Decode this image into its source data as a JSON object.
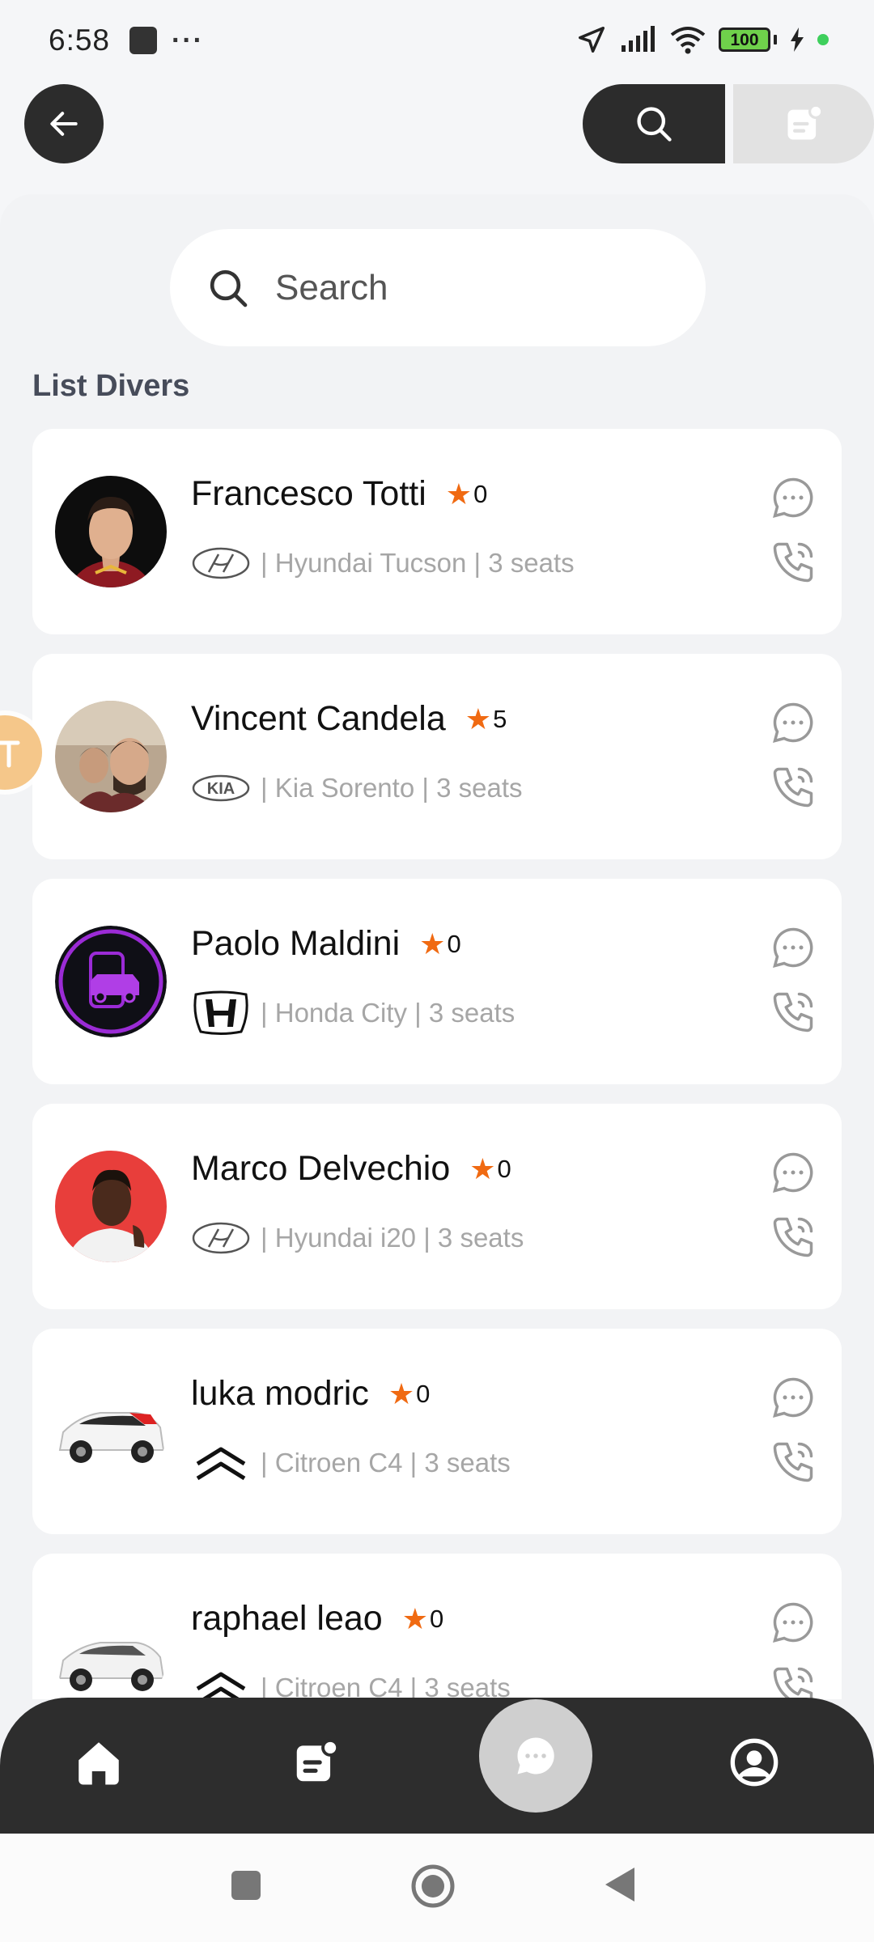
{
  "status_bar": {
    "time": "6:58",
    "battery": "100"
  },
  "search": {
    "placeholder": "Search"
  },
  "list_title": "List Divers",
  "drivers": [
    {
      "name": "Francesco Totti",
      "rating": "0",
      "car": "| Hyundai Tucson | 3 seats",
      "brand_icon": "hyundai-logo-icon"
    },
    {
      "name": "Vincent Candela",
      "rating": "5",
      "car": "| Kia Sorento | 3 seats",
      "brand_icon": "kia-logo-icon"
    },
    {
      "name": "Paolo Maldini",
      "rating": "0",
      "car": "| Honda City | 3 seats",
      "brand_icon": "honda-logo-icon"
    },
    {
      "name": "Marco Delvechio",
      "rating": "0",
      "car": "| Hyundai i20 | 3 seats",
      "brand_icon": "hyundai-logo-icon"
    },
    {
      "name": "luka modric",
      "rating": "0",
      "car": "| Citroen C4 | 3 seats",
      "brand_icon": "citroen-logo-icon"
    },
    {
      "name": "raphael leao",
      "rating": "0",
      "car": "| Citroen C4 | 3 seats",
      "brand_icon": "citroen-logo-icon"
    }
  ],
  "colors": {
    "dark": "#2c2c2c",
    "accent_star": "#f06a12",
    "muted_text": "#a6a6a6",
    "background": "#f2f3f5"
  },
  "bottom_nav": [
    "home-icon",
    "document-icon",
    "chat-icon",
    "profile-icon"
  ]
}
